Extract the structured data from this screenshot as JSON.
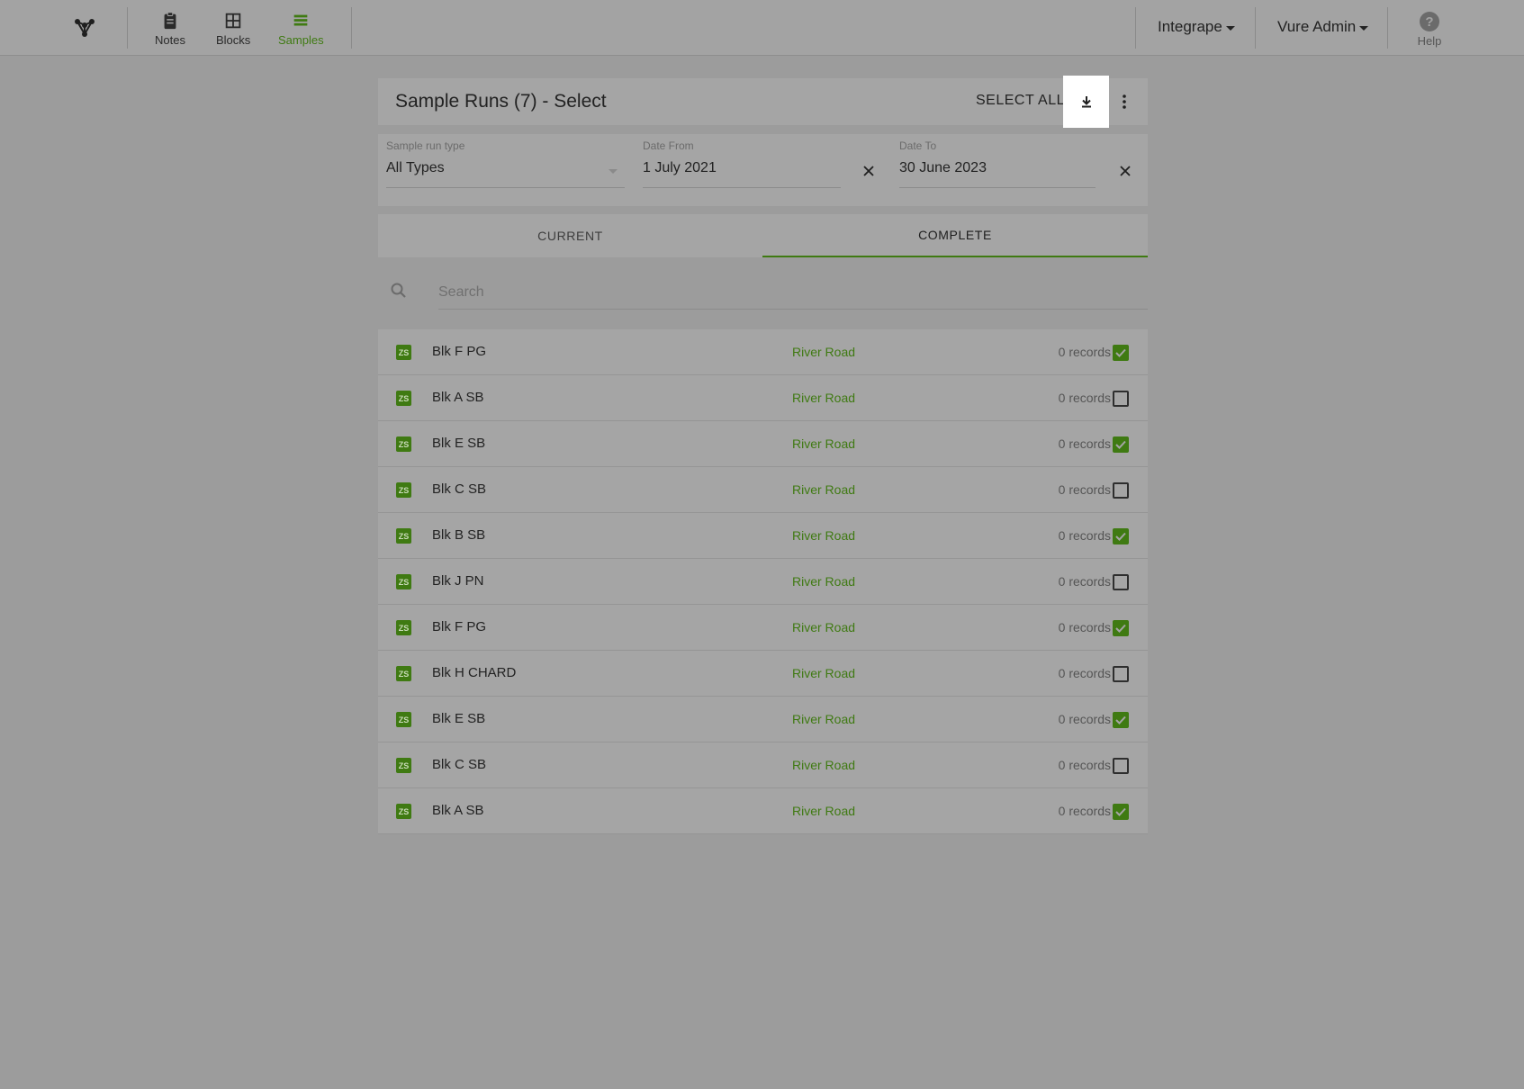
{
  "nav": {
    "items": [
      {
        "label": "Notes",
        "icon": "clipboard-icon"
      },
      {
        "label": "Blocks",
        "icon": "grid-icon"
      },
      {
        "label": "Samples",
        "icon": "list-icon"
      }
    ],
    "org": "Integrape",
    "user": "Vure Admin",
    "help": "Help"
  },
  "header": {
    "title": "Sample Runs (7) - Select",
    "select_all": "SELECT ALL"
  },
  "filters": {
    "type_label": "Sample run type",
    "type_value": "All Types",
    "from_label": "Date From",
    "from_value": "1 July 2021",
    "to_label": "Date To",
    "to_value": "30 June 2023"
  },
  "tabs": [
    "CURRENT",
    "COMPLETE"
  ],
  "active_tab": "COMPLETE",
  "search": {
    "placeholder": "Search"
  },
  "rows": [
    {
      "badge": "ZS",
      "name": "Blk F PG",
      "location": "River Road",
      "records": "0 records",
      "checked": true
    },
    {
      "badge": "ZS",
      "name": "Blk A SB",
      "location": "River Road",
      "records": "0 records",
      "checked": false
    },
    {
      "badge": "ZS",
      "name": "Blk E SB",
      "location": "River Road",
      "records": "0 records",
      "checked": true
    },
    {
      "badge": "ZS",
      "name": "Blk C SB",
      "location": "River Road",
      "records": "0 records",
      "checked": false
    },
    {
      "badge": "ZS",
      "name": "Blk B SB",
      "location": "River Road",
      "records": "0 records",
      "checked": true
    },
    {
      "badge": "ZS",
      "name": "Blk J PN",
      "location": "River Road",
      "records": "0 records",
      "checked": false
    },
    {
      "badge": "ZS",
      "name": "Blk F PG",
      "location": "River Road",
      "records": "0 records",
      "checked": true
    },
    {
      "badge": "ZS",
      "name": "Blk H CHARD",
      "location": "River Road",
      "records": "0 records",
      "checked": false
    },
    {
      "badge": "ZS",
      "name": "Blk E SB",
      "location": "River Road",
      "records": "0 records",
      "checked": true
    },
    {
      "badge": "ZS",
      "name": "Blk C SB",
      "location": "River Road",
      "records": "0 records",
      "checked": false
    },
    {
      "badge": "ZS",
      "name": "Blk A SB",
      "location": "River Road",
      "records": "0 records",
      "checked": true
    }
  ],
  "colors": {
    "accent": "#3f7a12",
    "overlay": "#9c9c9c"
  }
}
